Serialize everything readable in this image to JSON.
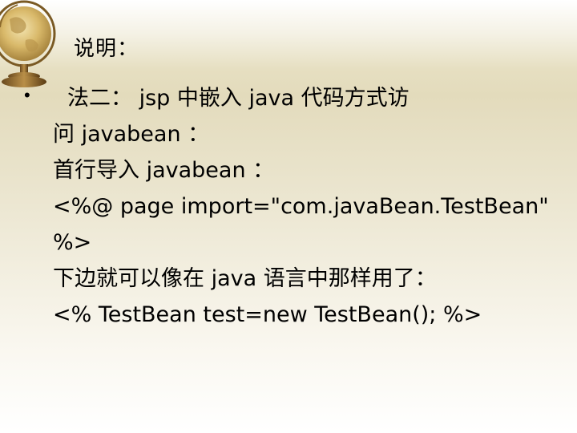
{
  "slide": {
    "title": "说明：",
    "bullet_symbol": "•",
    "lines": [
      "法二： jsp 中嵌入 java 代码方式访",
      "问 javabean ：",
      "首行导入 javabean ：",
      "<%@ page import=\"com.javaBean.TestBean\"",
      "%>",
      "下边就可以像在 java 语言中那样用了：",
      "<% TestBean test=new TestBean(); %>"
    ]
  }
}
